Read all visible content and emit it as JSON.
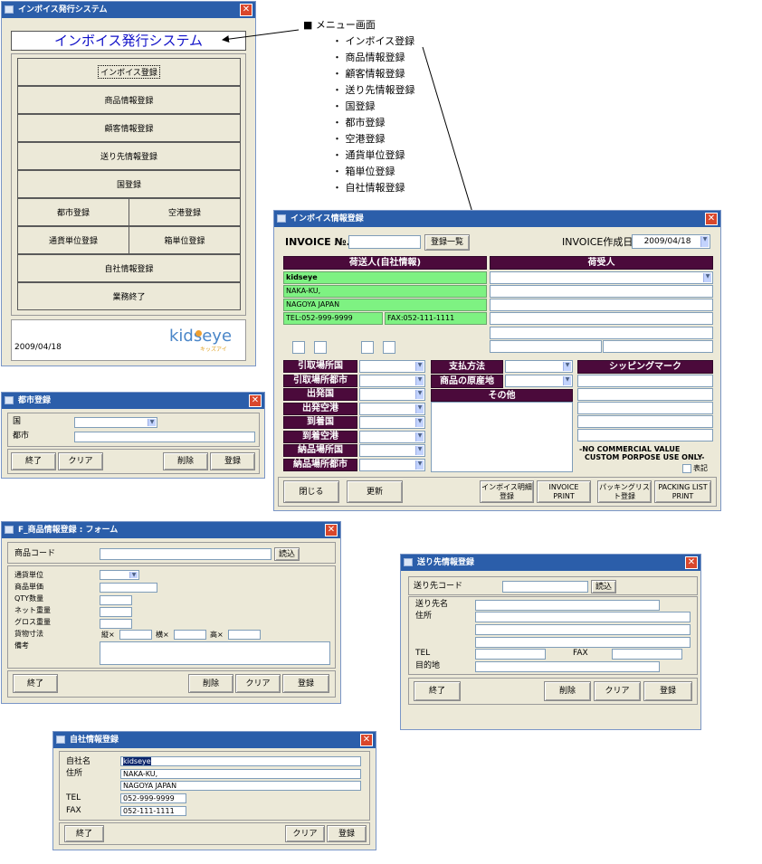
{
  "menu": {
    "title": "インボイス発行システム",
    "header": "インボイス発行システム",
    "items": [
      "インボイス登録",
      "商品情報登録",
      "顧客情報登録",
      "送り先情報登録",
      "国登録"
    ],
    "pairs": [
      [
        "都市登録",
        "空港登録"
      ],
      [
        "通貨単位登録",
        "箱単位登録"
      ]
    ],
    "items2": [
      "自社情報登録",
      "業務終了"
    ],
    "date": "2009/04/18",
    "logo": "kidseye",
    "logo_sub": "キッズアイ"
  },
  "annotation": {
    "title": "メニュー画面",
    "items": [
      "インボイス登録",
      "商品情報登録",
      "顧客情報登録",
      "送り先情報登録",
      "国登録",
      "都市登録",
      "空港登録",
      "通貨単位登録",
      "箱単位登録",
      "自社情報登録"
    ]
  },
  "city": {
    "title": "都市登録",
    "country_label": "国",
    "city_label": "都市",
    "btn_end": "終了",
    "btn_clear": "クリア",
    "btn_delete": "削除",
    "btn_register": "登録"
  },
  "invoice": {
    "title": "インボイス情報登録",
    "no_label": "INVOICE №.",
    "list_button": "登録一覧",
    "date_label": "INVOICE作成日",
    "date_value": "2009/04/18",
    "shipper_header": "荷送人(自社情報)",
    "consignee_header": "荷受人",
    "shipper_lines": [
      "kidseye",
      "NAKA-KU,",
      "NAGOYA JAPAN"
    ],
    "tel": "TEL:052-999-9999",
    "fax": "FAX:052-111-1111",
    "left_labels": [
      "引取場所国",
      "引取場所都市",
      "出発国",
      "出発空港",
      "到着国",
      "到着空港",
      "納品場所国",
      "納品場所都市"
    ],
    "payment_label": "支払方法",
    "origin_label": "商品の原産地",
    "other_label": "その他",
    "shipping_mark": "シッピングマーク",
    "note1": "-NO COMMERCIAL VALUE",
    "note2": "CUSTOM PORPOSE USE ONLY-",
    "check_label": "表記",
    "btn_close": "閉じる",
    "btn_update": "更新",
    "btn_detail": "インボイス明細登録",
    "btn_invoice_print": "INVOICE PRINT",
    "btn_packing": "パッキングリスト登録",
    "btn_packing_print": "PACKING LIST PRINT"
  },
  "product": {
    "title": "F_商品情報登録 : フォーム",
    "code_label": "商品コード",
    "load_button": "読込",
    "labels": [
      "通貨単位",
      "商品単価",
      "QTY数量",
      "ネット重量",
      "グロス重量",
      "貨物寸法",
      "備考"
    ],
    "dim_v": "縦×",
    "dim_h": "横×",
    "dim_t": "高×",
    "btn_end": "終了",
    "btn_delete": "削除",
    "btn_clear": "クリア",
    "btn_register": "登録"
  },
  "dest": {
    "title": "送り先情報登録",
    "code_label": "送り先コード",
    "load_button": "読込",
    "name_label": "送り先名",
    "address_label": "住所",
    "tel_label": "TEL",
    "fax_label": "FAX",
    "purpose_label": "目的地",
    "btn_end": "終了",
    "btn_delete": "削除",
    "btn_clear": "クリア",
    "btn_register": "登録"
  },
  "company": {
    "title": "自社情報登録",
    "name_label": "自社名",
    "address_label": "住所",
    "tel_label": "TEL",
    "fax_label": "FAX",
    "name_value": "kidseye",
    "address1": "NAKA-KU,",
    "address2": "NAGOYA JAPAN",
    "tel_value": "052-999-9999",
    "fax_value": "052-111-1111",
    "btn_end": "終了",
    "btn_clear": "クリア",
    "btn_register": "登録"
  }
}
